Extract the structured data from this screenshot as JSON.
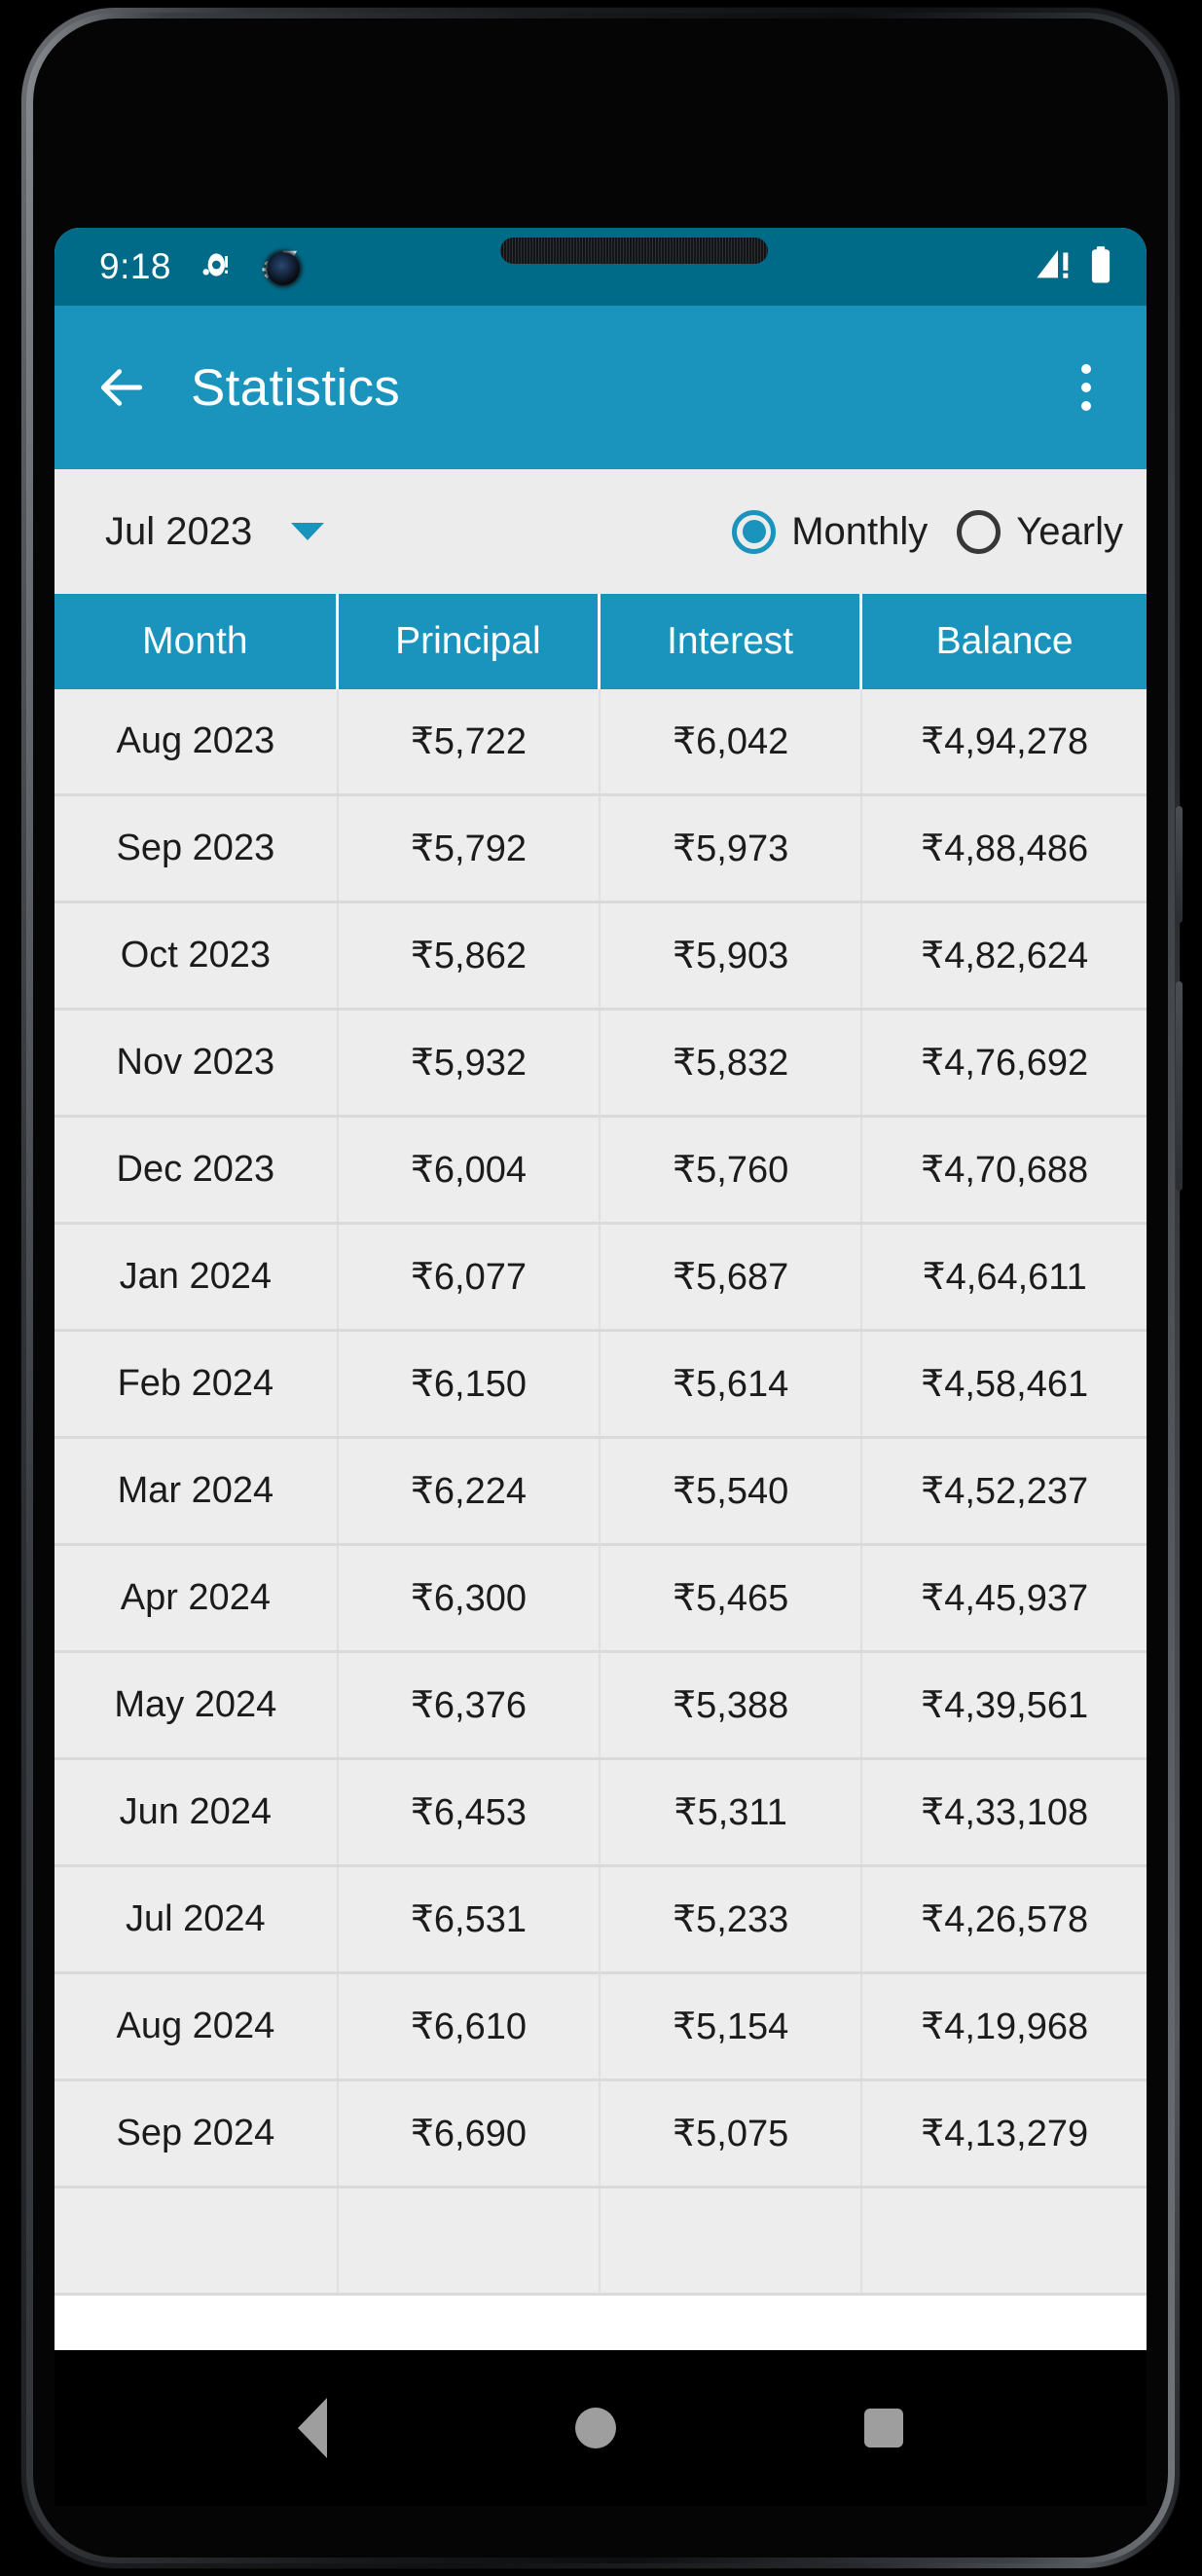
{
  "status_bar": {
    "time": "9:18",
    "left_icons": [
      "alarm-dot-icon",
      "settings-wifi-icon"
    ],
    "right_icons": [
      "signal-no-service-icon",
      "battery-full-icon"
    ],
    "background": "#006B89"
  },
  "app_bar": {
    "back_icon": "back-arrow-icon",
    "title": "Statistics",
    "overflow_icon": "overflow-menu-icon",
    "background": "#1A94BC"
  },
  "filter_row": {
    "period": "Jul 2023",
    "caret_icon": "dropdown-caret-icon",
    "options": [
      {
        "label": "Monthly",
        "selected": true
      },
      {
        "label": "Yearly",
        "selected": false
      }
    ],
    "accent": "#1A94BC"
  },
  "table": {
    "columns": [
      "Month",
      "Principal",
      "Interest",
      "Balance"
    ],
    "rows": [
      {
        "month": "Aug 2023",
        "principal": "₹5,722",
        "interest": "₹6,042",
        "balance": "₹4,94,278"
      },
      {
        "month": "Sep 2023",
        "principal": "₹5,792",
        "interest": "₹5,973",
        "balance": "₹4,88,486"
      },
      {
        "month": "Oct 2023",
        "principal": "₹5,862",
        "interest": "₹5,903",
        "balance": "₹4,82,624"
      },
      {
        "month": "Nov 2023",
        "principal": "₹5,932",
        "interest": "₹5,832",
        "balance": "₹4,76,692"
      },
      {
        "month": "Dec 2023",
        "principal": "₹6,004",
        "interest": "₹5,760",
        "balance": "₹4,70,688"
      },
      {
        "month": "Jan 2024",
        "principal": "₹6,077",
        "interest": "₹5,687",
        "balance": "₹4,64,611"
      },
      {
        "month": "Feb 2024",
        "principal": "₹6,150",
        "interest": "₹5,614",
        "balance": "₹4,58,461"
      },
      {
        "month": "Mar 2024",
        "principal": "₹6,224",
        "interest": "₹5,540",
        "balance": "₹4,52,237"
      },
      {
        "month": "Apr 2024",
        "principal": "₹6,300",
        "interest": "₹5,465",
        "balance": "₹4,45,937"
      },
      {
        "month": "May 2024",
        "principal": "₹6,376",
        "interest": "₹5,388",
        "balance": "₹4,39,561"
      },
      {
        "month": "Jun 2024",
        "principal": "₹6,453",
        "interest": "₹5,311",
        "balance": "₹4,33,108"
      },
      {
        "month": "Jul 2024",
        "principal": "₹6,531",
        "interest": "₹5,233",
        "balance": "₹4,26,578"
      },
      {
        "month": "Aug 2024",
        "principal": "₹6,610",
        "interest": "₹5,154",
        "balance": "₹4,19,968"
      },
      {
        "month": "Sep 2024",
        "principal": "₹6,690",
        "interest": "₹5,075",
        "balance": "₹4,13,279"
      },
      {
        "month": "",
        "principal": "",
        "interest": "",
        "balance": ""
      }
    ]
  },
  "nav_bar": {
    "back_icon": "nav-back-triangle-icon",
    "home_icon": "nav-home-circle-icon",
    "recents_icon": "nav-recents-square-icon"
  }
}
